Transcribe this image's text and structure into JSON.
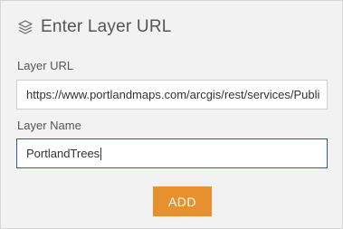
{
  "header": {
    "title": "Enter Layer URL",
    "icon": "layers-icon"
  },
  "form": {
    "url_label": "Layer URL",
    "url_value": "https://www.portlandmaps.com/arcgis/rest/services/Publi",
    "name_label": "Layer Name",
    "name_value": "PortlandTrees"
  },
  "actions": {
    "add_label": "ADD"
  },
  "colors": {
    "accent": "#e88f2e",
    "focus_border": "#2f5aa8",
    "panel_bg": "#f2f2f2"
  }
}
